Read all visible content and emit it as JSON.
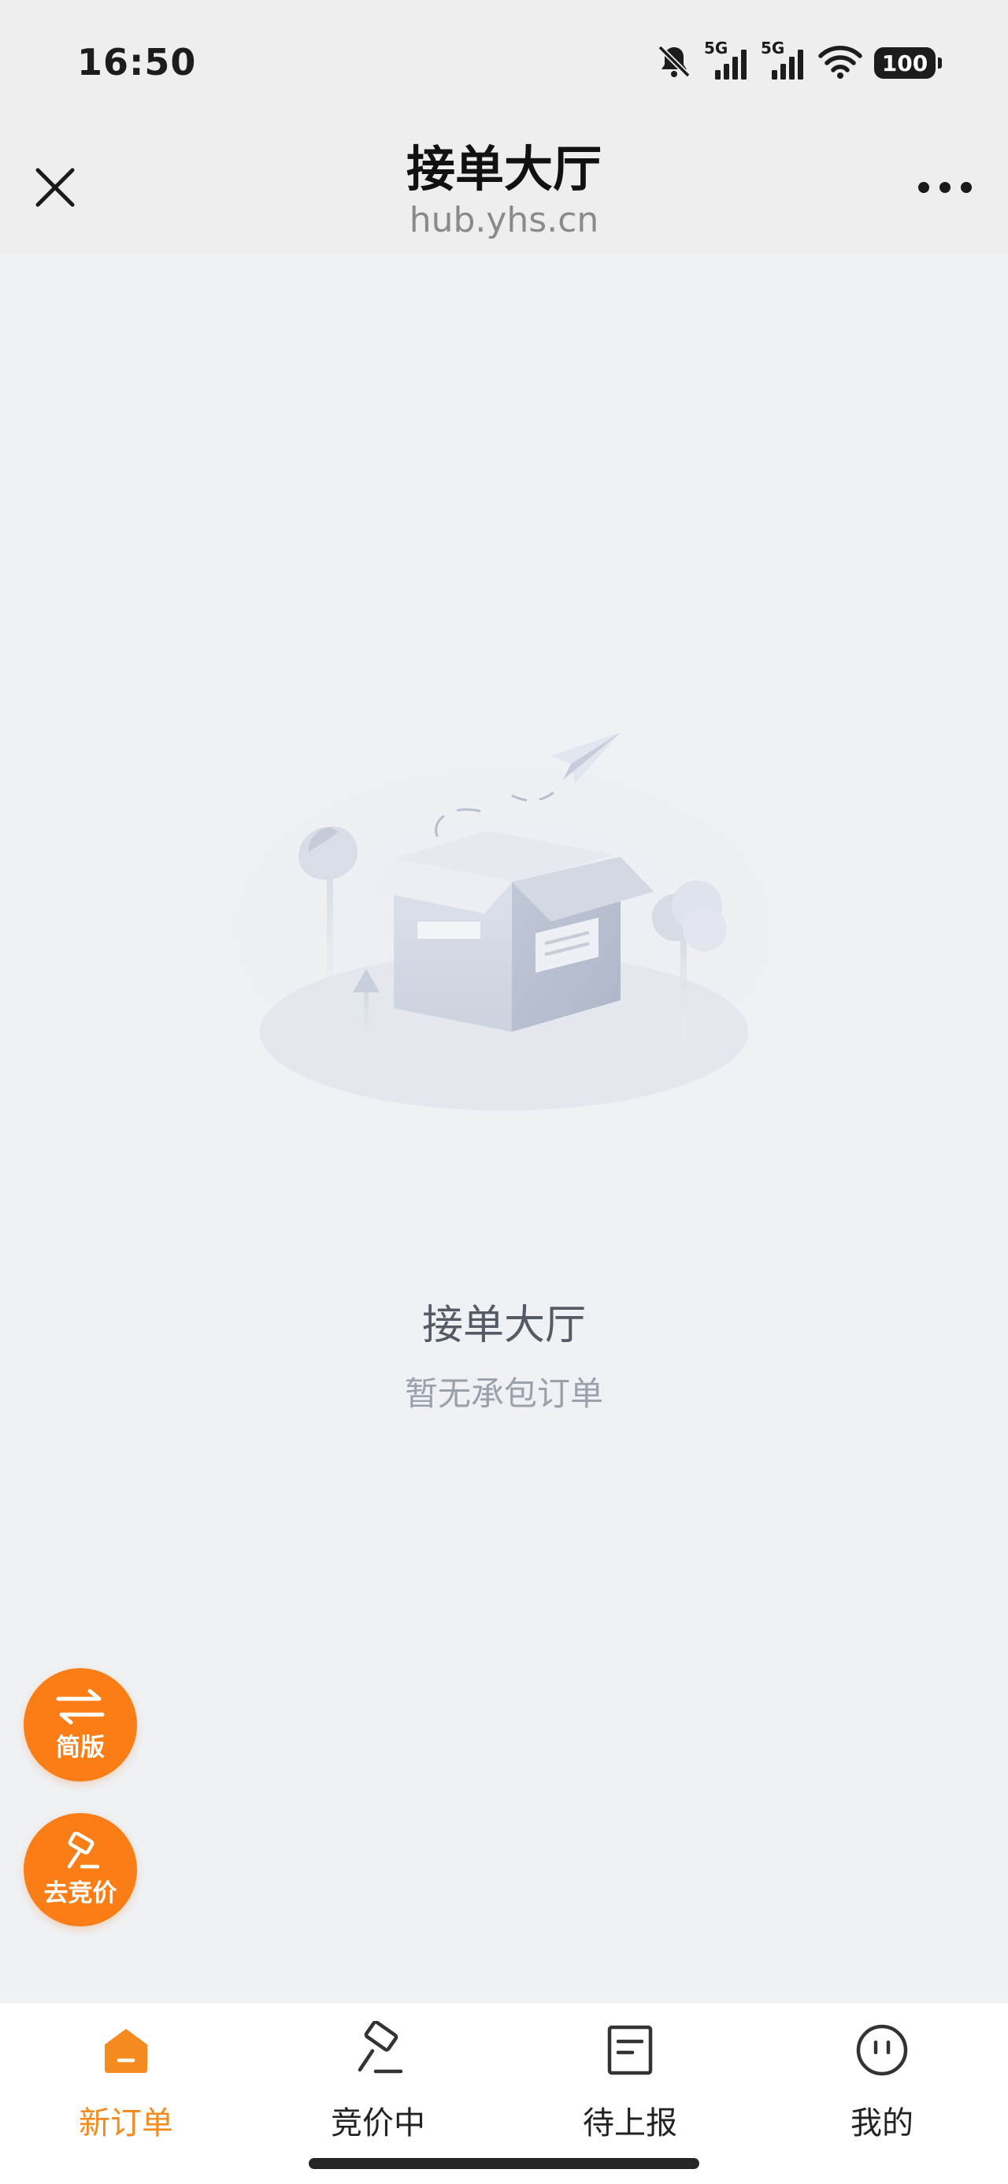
{
  "status_bar": {
    "time": "16:50",
    "signal_1": "5G",
    "signal_2": "5G",
    "battery": "100",
    "icons": [
      "bell-muted-icon",
      "signal-icon",
      "signal-icon",
      "wifi-icon",
      "battery-icon"
    ]
  },
  "nav": {
    "title": "接单大厅",
    "url": "hub.yhs.cn",
    "close_icon": "close-icon",
    "more_icon": "more-icon"
  },
  "empty_state": {
    "title": "接单大厅",
    "subtitle": "暂无承包订单",
    "illustration": "empty-box-illustration"
  },
  "fabs": {
    "simple_label": "简版",
    "simple_icon": "swap-arrows-icon",
    "bid_label": "去竞价",
    "bid_icon": "gavel-icon",
    "color": "#fa7d15"
  },
  "tabs": [
    {
      "label": "新订单",
      "icon": "home-icon",
      "active": true
    },
    {
      "label": "竞价中",
      "icon": "gavel-icon",
      "active": false
    },
    {
      "label": "待上报",
      "icon": "document-icon",
      "active": false
    },
    {
      "label": "我的",
      "icon": "face-icon",
      "active": false
    }
  ],
  "colors": {
    "accent": "#f58a1f",
    "background": "#eff1f4",
    "header": "#eeeeee"
  }
}
